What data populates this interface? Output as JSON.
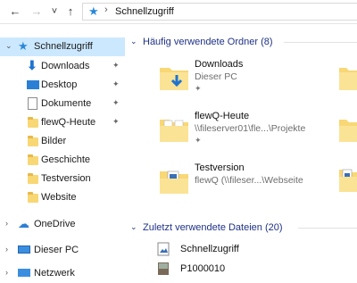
{
  "address": {
    "back": "←",
    "forward": "→",
    "recent": "˅",
    "up": "↑",
    "separator": "›",
    "crumb": "Schnellzugriff"
  },
  "sidebar": {
    "items": [
      {
        "label": "Schnellzugriff",
        "icon": "star-icon",
        "selected": true
      },
      {
        "label": "Downloads",
        "icon": "download-icon",
        "pinned": true
      },
      {
        "label": "Desktop",
        "icon": "desktop-icon",
        "pinned": true
      },
      {
        "label": "Dokumente",
        "icon": "documents-icon",
        "pinned": true
      },
      {
        "label": "flewQ-Heute",
        "icon": "folder-icon",
        "pinned": true
      },
      {
        "label": "Bilder",
        "icon": "folder-icon"
      },
      {
        "label": "Geschichte",
        "icon": "folder-icon"
      },
      {
        "label": "Testversion",
        "icon": "folder-icon"
      },
      {
        "label": "Website",
        "icon": "folder-icon"
      },
      {
        "label": "OneDrive",
        "icon": "cloud-icon"
      },
      {
        "label": "Dieser PC",
        "icon": "computer-icon"
      },
      {
        "label": "Netzwerk",
        "icon": "network-icon"
      }
    ],
    "pin_glyph": "📌"
  },
  "frequent": {
    "title": "Häufig verwendete Ordner (8)",
    "tiles": [
      {
        "name": "Downloads",
        "location": "Dieser PC",
        "pinned": true
      },
      {
        "name": "flewQ-Heute",
        "location": "\\\\fileserver01\\fle...\\Projekte",
        "pinned": true
      },
      {
        "name": "Testversion",
        "location": "flewQ (\\\\fileser...\\Webseite",
        "pinned": false
      }
    ]
  },
  "recent": {
    "title": "Zuletzt verwendete Dateien (20)",
    "files": [
      {
        "name": "Schnellzugriff"
      },
      {
        "name": "P1000010"
      }
    ]
  },
  "colors": {
    "accent": "#2b88d8",
    "selection": "#cce8ff",
    "group_header": "#1e3287",
    "folder": "#f8d775"
  }
}
